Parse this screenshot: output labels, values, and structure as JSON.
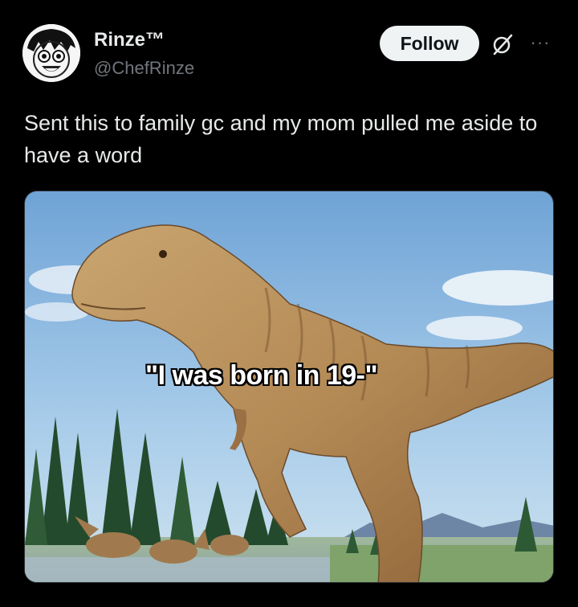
{
  "post": {
    "author_name": "Rinze™",
    "author_handle": "@ChefRinze",
    "follow_label": "Follow",
    "more_label": "···",
    "text": "Sent this to family gc and my mom pulled me aside to have a word",
    "avatar_icon": "anime-face-avatar",
    "grok_icon": "grok-slash-icon"
  },
  "media": {
    "caption": "\"I was born in 19-\""
  },
  "colors": {
    "background": "#000000",
    "text": "#e7e9ea",
    "secondary": "#71767b",
    "follow_bg": "#eff3f4"
  }
}
